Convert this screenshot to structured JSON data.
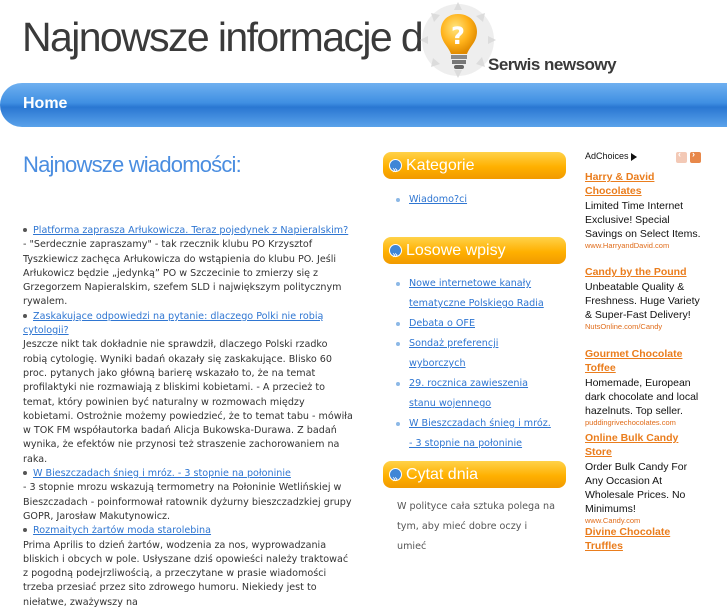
{
  "header": {
    "title": "Najnowsze informacje dnia",
    "subtitle": "Serwis newsowy",
    "logo_icon": "lightbulb-question-icon"
  },
  "nav": {
    "home": "Home"
  },
  "main": {
    "heading": "Najnowsze wiadomości:",
    "items": [
      {
        "link": "Platforma zaprasza Arłukowicza. Teraz pojedynek z Napieralskim?",
        "body": "- \"Serdecznie zapraszamy\" - tak rzecznik klubu PO Krzysztof Tyszkiewicz zachęca Arłukowicza do wstąpienia do klubu PO. Jeśli Arłukowicz będzie „jedynką” PO w Szczecinie to zmierzy się z Grzegorzem Napieralskim, szefem SLD i największym politycznym rywalem."
      },
      {
        "link": "Zaskakujące odpowiedzi na pytanie: dlaczego Polki nie robią cytologii?",
        "body": "Jeszcze nikt tak dokładnie nie sprawdził, dlaczego Polski rzadko robią cytologię. Wyniki badań okazały się zaskakujące. Blisko 60 proc. pytanych jako główną barierę wskazało to, że na temat profilaktyki nie rozmawiają z bliskimi kobietami. - A przecież to temat, który powinien być naturalny w rozmowach między kobietami. Ostrożnie możemy powiedzieć, że to temat tabu - mówiła w TOK FM współautorka badań Alicja Bukowska-Durawa. Z badań wynika, że efektów nie przynosi też straszenie zachorowaniem na raka."
      },
      {
        "link": "W Bieszczadach śnieg i mróz. - 3 stopnie na połoninie",
        "body": "- 3 stopnie mrozu wskazują termometry na Połoninie Wetlińskiej w Bieszczadach - poinformował ratownik dyżurny bieszczadzkiej grupy GOPR, Jarosław Makutynowicz."
      },
      {
        "link": "Rozmaitych żartów moda starolebina",
        "body": "Prima Aprilis to dzień żartów, wodzenia za nos, wyprowadzania bliskich i obcych w pole. Usłyszane dziś opowieści należy traktować z pogodną podejrzliwością, a przeczytane w prasie wiadomości trzeba przesiać przez sito zdrowego humoru. Niekiedy jest to niełatwe, zważywszy na"
      }
    ]
  },
  "sidebar": {
    "categories": {
      "title": "Kategorie",
      "items": [
        "Wiadomo?ci"
      ]
    },
    "random_posts": {
      "title": "Losowe wpisy",
      "items": [
        "Nowe internetowe kanały tematyczne Polskiego Radia",
        "Debata o OFE",
        "Sondaż preferencji wyborczych",
        "29. rocznica zawieszenia stanu wojennego",
        "W Bieszczadach śnieg i mróz. - 3 stopnie na połoninie"
      ]
    },
    "quote": {
      "title": "Cytat dnia",
      "text": "W polityce cała sztuka polega na tym, aby mieć dobre oczy i umieć"
    }
  },
  "ads": {
    "label": "AdChoices",
    "items": [
      {
        "title": "Harry & David Chocolates",
        "text": "Limited Time Internet Exclusive! Special Savings on Select Items.",
        "url": "www.HarryandDavid.com"
      },
      {
        "title": "Candy by the Pound",
        "text": "Unbeatable Quality & Freshness. Huge Variety & Super-Fast Delivery!",
        "url": "NutsOnline.com/Candy"
      },
      {
        "title": "Gourmet Chocolate Toffee",
        "text": "Homemade, European dark chocolate and local hazelnuts. Top seller.",
        "url": "puddingrivechocolates.com"
      },
      {
        "title": "Online Bulk Candy Store",
        "text": "Order Bulk Candy For Any Occasion At Wholesale Prices. No Minimums!",
        "url": "www.Candy.com"
      },
      {
        "title": "Divine Chocolate Truffles",
        "text": "",
        "url": ""
      }
    ]
  }
}
